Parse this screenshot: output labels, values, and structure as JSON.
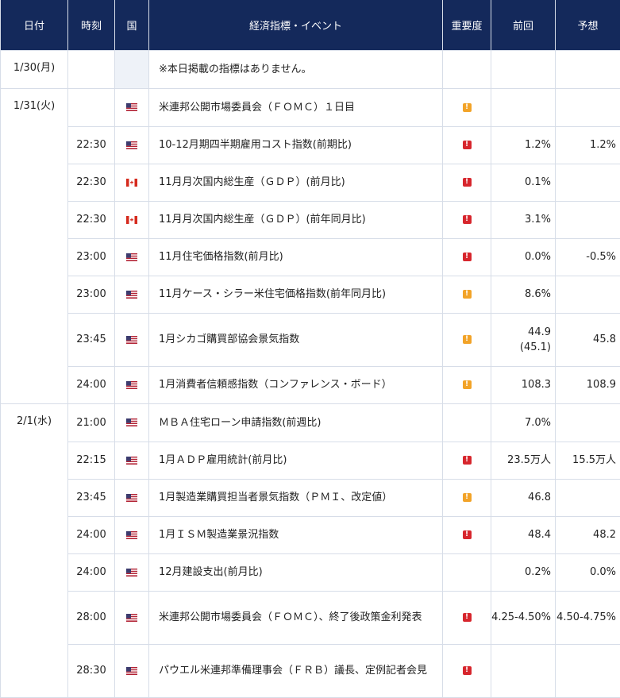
{
  "header": {
    "date": "日付",
    "time": "時刻",
    "country": "国",
    "event": "経済指標・イベント",
    "importance": "重要度",
    "previous": "前回",
    "forecast": "予想"
  },
  "colors": {
    "header_bg": "#14295b",
    "importance_high": "#d7262d",
    "importance_mid": "#f2a328"
  },
  "rows": [
    {
      "date": "1/30(月)",
      "time": "",
      "country": "",
      "event": "※本日掲載の指標はありません。",
      "importance": "",
      "previous": "",
      "forecast": ""
    },
    {
      "date": "1/31(火)",
      "time": "",
      "country": "us-flag",
      "event": "米連邦公開市場委員会（ＦＯＭＣ）１日目",
      "importance": "mid",
      "previous": "",
      "forecast": ""
    },
    {
      "date": "",
      "time": "22:30",
      "country": "us-flag",
      "event": "10-12月期四半期雇用コスト指数(前期比)",
      "importance": "high",
      "previous": "1.2%",
      "forecast": "1.2%"
    },
    {
      "date": "",
      "time": "22:30",
      "country": "ca-flag",
      "event": "11月月次国内総生産（ＧＤＰ）(前月比)",
      "importance": "high",
      "previous": "0.1%",
      "forecast": ""
    },
    {
      "date": "",
      "time": "22:30",
      "country": "ca-flag",
      "event": "11月月次国内総生産（ＧＤＰ）(前年同月比)",
      "importance": "high",
      "previous": "3.1%",
      "forecast": ""
    },
    {
      "date": "",
      "time": "23:00",
      "country": "us-flag",
      "event": "11月住宅価格指数(前月比)",
      "importance": "high",
      "previous": "0.0%",
      "forecast": "-0.5%"
    },
    {
      "date": "",
      "time": "23:00",
      "country": "us-flag",
      "event": "11月ケース・シラー米住宅価格指数(前年同月比)",
      "importance": "mid",
      "previous": "8.6%",
      "forecast": ""
    },
    {
      "date": "",
      "time": "23:45",
      "country": "us-flag",
      "event": "1月シカゴ購買部協会景気指数",
      "importance": "mid",
      "previous": "44.9",
      "previous_revised": "(45.1)",
      "forecast": "45.8"
    },
    {
      "date": "",
      "time": "24:00",
      "country": "us-flag",
      "event": "1月消費者信頼感指数（コンファレンス・ボード）",
      "importance": "mid",
      "previous": "108.3",
      "forecast": "108.9"
    },
    {
      "date": "2/1(水)",
      "time": "21:00",
      "country": "us-flag",
      "event": "ＭＢＡ住宅ローン申請指数(前週比)",
      "importance": "",
      "previous": "7.0%",
      "forecast": ""
    },
    {
      "date": "",
      "time": "22:15",
      "country": "us-flag",
      "event": "1月ＡＤＰ雇用統計(前月比)",
      "importance": "high",
      "previous": "23.5万人",
      "forecast": "15.5万人"
    },
    {
      "date": "",
      "time": "23:45",
      "country": "us-flag",
      "event": "1月製造業購買担当者景気指数（ＰＭＩ、改定値）",
      "importance": "mid",
      "previous": "46.8",
      "forecast": ""
    },
    {
      "date": "",
      "time": "24:00",
      "country": "us-flag",
      "event": "1月ＩＳＭ製造業景況指数",
      "importance": "high",
      "previous": "48.4",
      "forecast": "48.2"
    },
    {
      "date": "",
      "time": "24:00",
      "country": "us-flag",
      "event": "12月建設支出(前月比)",
      "importance": "",
      "previous": "0.2%",
      "forecast": "0.0%"
    },
    {
      "date": "",
      "time": "28:00",
      "country": "us-flag",
      "event": "米連邦公開市場委員会（ＦＯＭＣ）、終了後政策金利発表",
      "importance": "high",
      "previous": "4.25-4.50%",
      "forecast": "4.50-4.75%"
    },
    {
      "date": "",
      "time": "28:30",
      "country": "us-flag",
      "event": "パウエル米連邦準備理事会（ＦＲＢ）議長、定例記者会見",
      "importance": "high",
      "previous": "",
      "forecast": ""
    }
  ]
}
